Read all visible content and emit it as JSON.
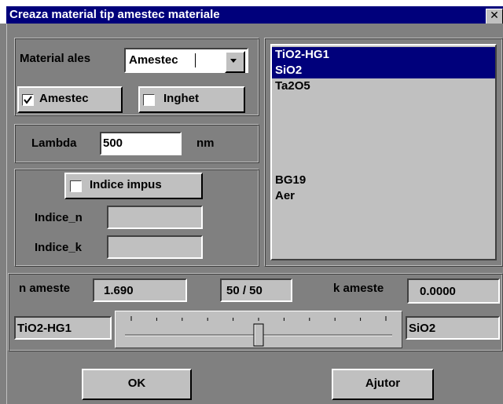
{
  "window": {
    "title": "Creaza material tip amestec materiale",
    "close_glyph": "✕"
  },
  "material": {
    "label": "Material ales",
    "value": "Amestec"
  },
  "checks": {
    "amestec": {
      "label": "Amestec",
      "checked": true
    },
    "inghet": {
      "label": "Inghet",
      "checked": false
    },
    "indice_impus": {
      "label": "Indice impus",
      "checked": false
    }
  },
  "lambda": {
    "label": "Lambda",
    "value": "500",
    "unit": "nm"
  },
  "indice": {
    "n_label": "Indice_n",
    "n_value": "",
    "k_label": "Indice_k",
    "k_value": ""
  },
  "list": {
    "items": [
      {
        "label": "TiO2-HG1",
        "selected": true
      },
      {
        "label": "SiO2",
        "selected": true
      },
      {
        "label": "Ta2O5",
        "selected": false
      },
      {
        "label": "",
        "selected": false
      },
      {
        "label": "",
        "selected": false
      },
      {
        "label": "",
        "selected": false
      },
      {
        "label": "",
        "selected": false
      },
      {
        "label": "",
        "selected": false
      },
      {
        "label": "BG19",
        "selected": false
      },
      {
        "label": "Aer",
        "selected": false
      }
    ]
  },
  "mix": {
    "n_label": "n ameste",
    "n_value": "1.690",
    "ratio": "50 / 50",
    "k_label": "k ameste",
    "k_value": "0.0000",
    "left_material": "TiO2-HG1",
    "right_material": "SiO2",
    "slider_fraction": 0.5
  },
  "buttons": {
    "ok": "OK",
    "help": "Ajutor"
  },
  "colors": {
    "titlebar": "#00007b",
    "selection": "#00007b",
    "face": "#c0c0c0",
    "background": "#808080"
  }
}
